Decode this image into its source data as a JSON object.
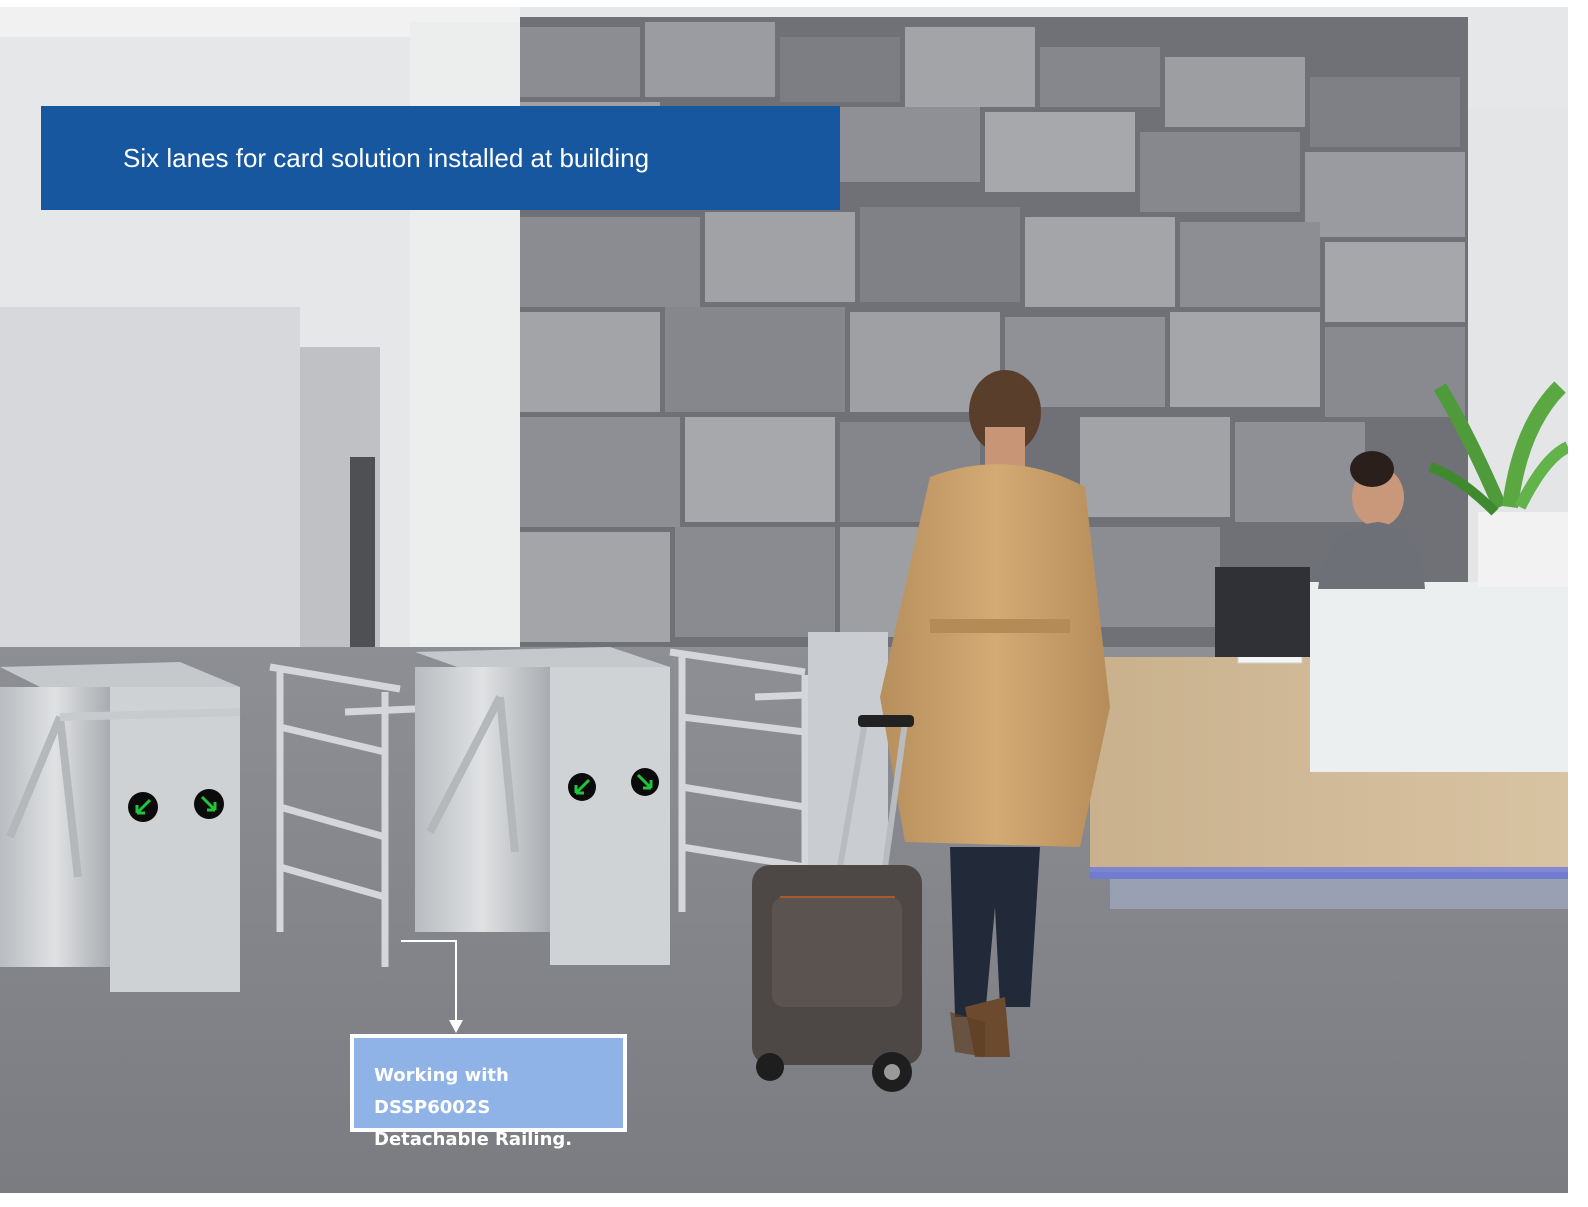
{
  "title": "Six lanes for card solution installed at building",
  "callout": {
    "line1": "Working with DSSP6002S",
    "line2": "Detachable Railing."
  },
  "colors": {
    "banner": "#1757a0",
    "callout_fill": "#8fb3e6",
    "indicator_green": "#22c43a"
  }
}
